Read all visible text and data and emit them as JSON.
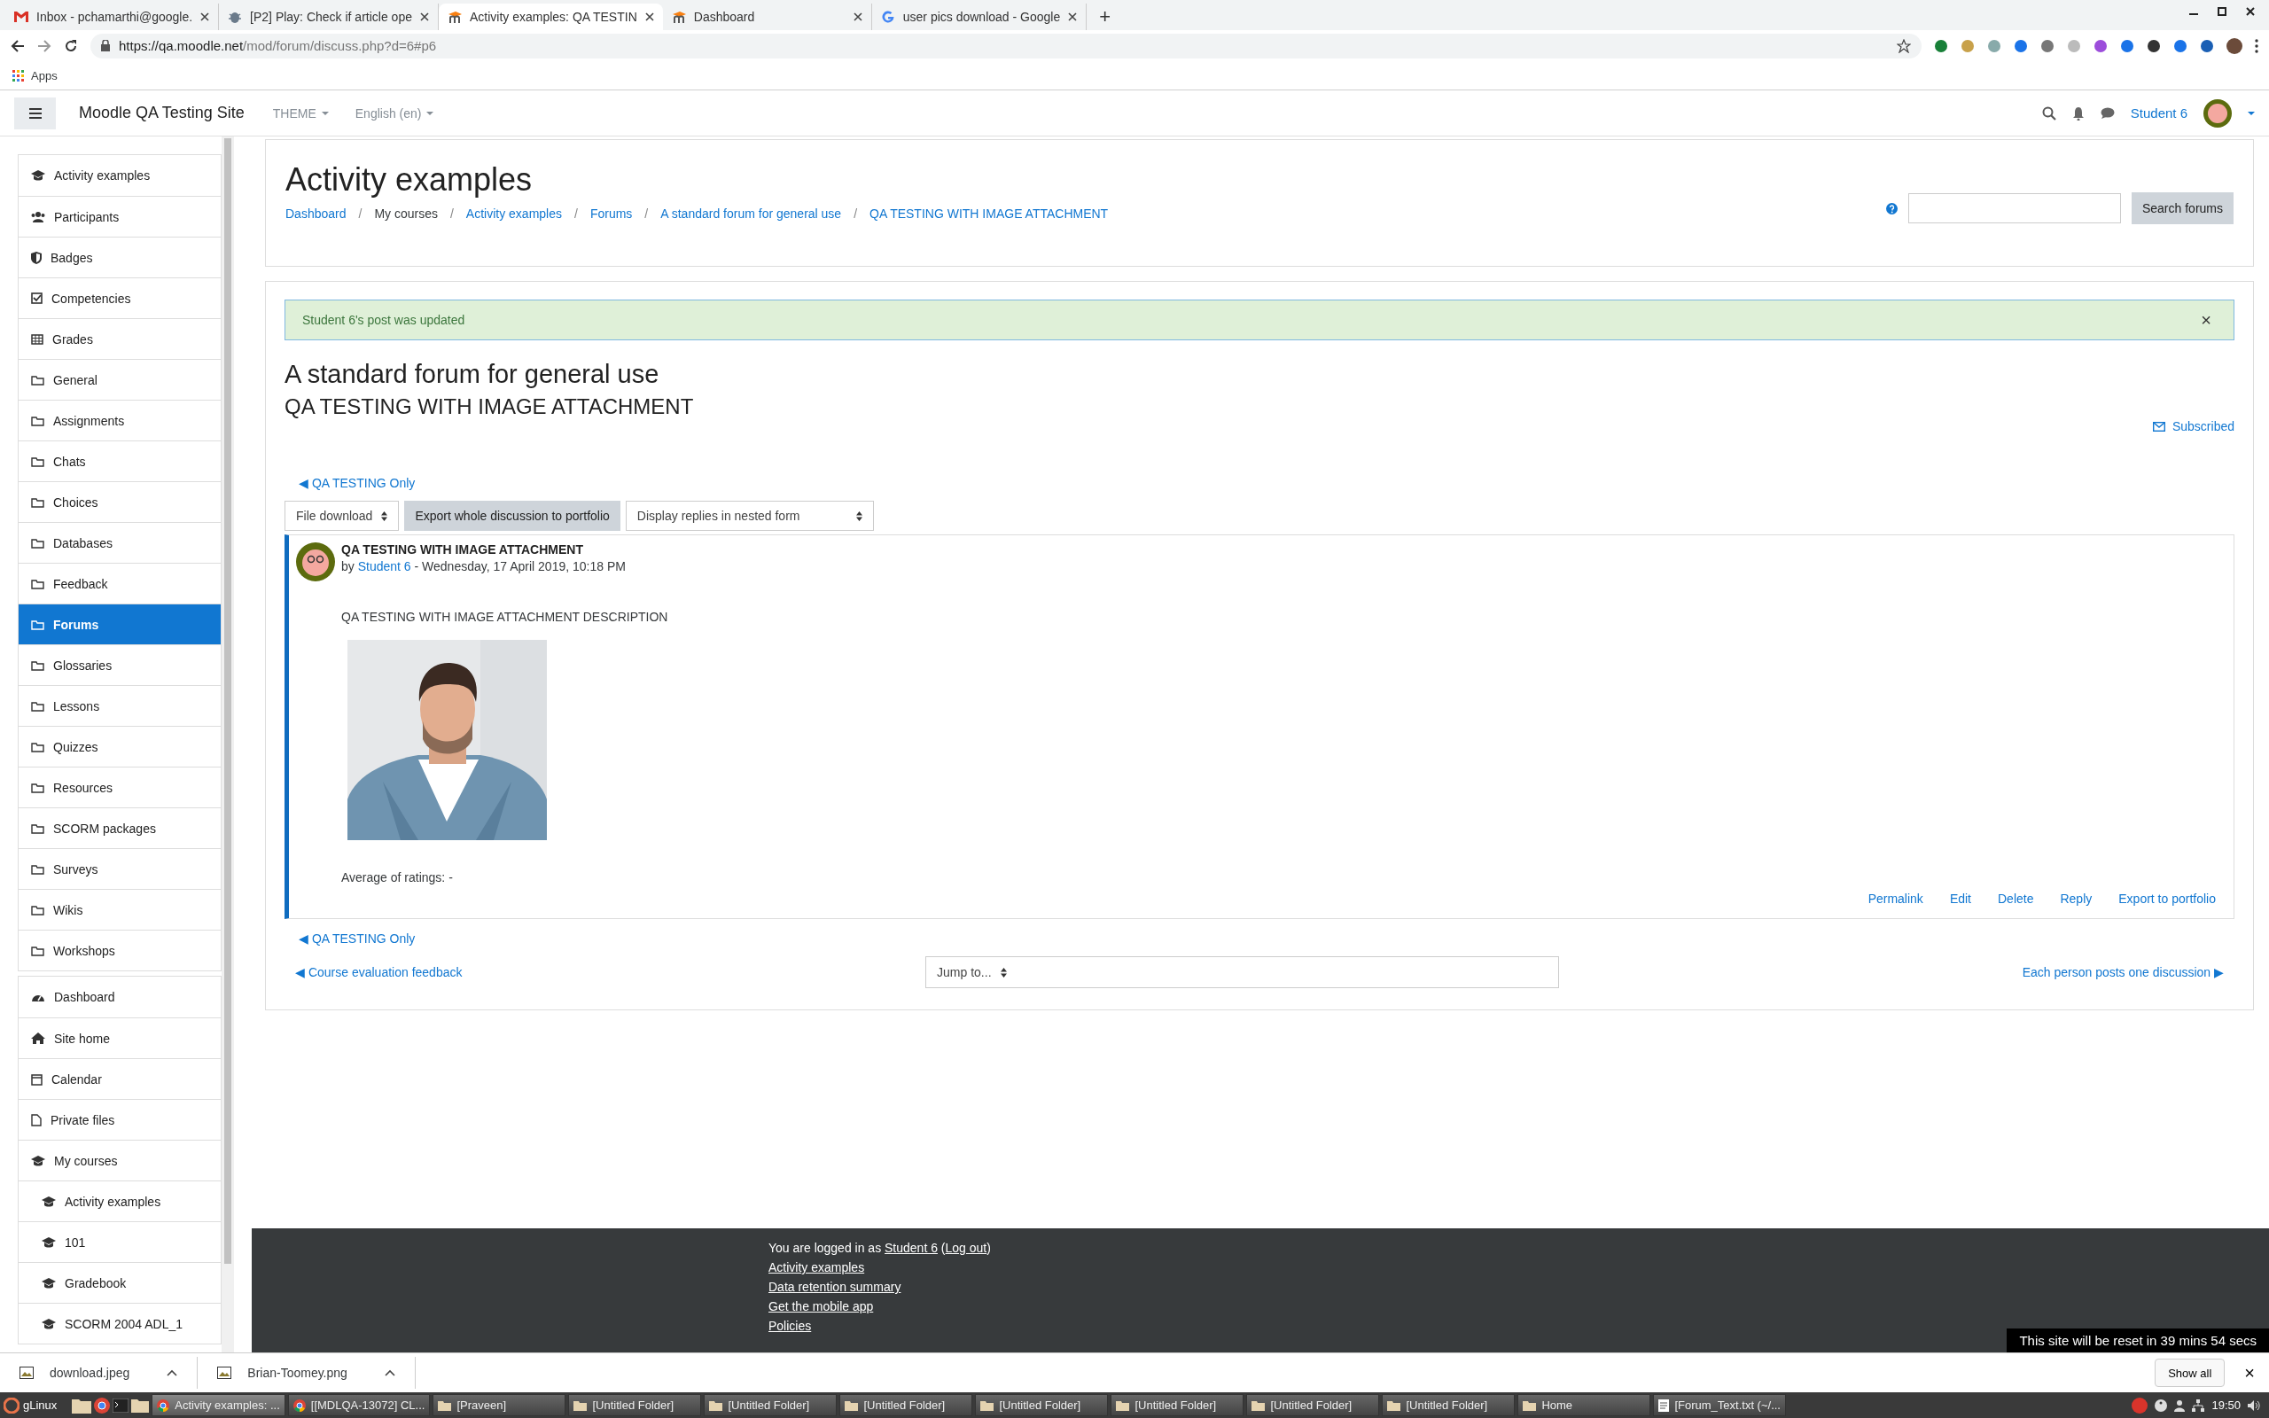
{
  "browser": {
    "tabs": [
      {
        "title": "Inbox - pchamarthi@google.",
        "kind": "gmail",
        "selected": false
      },
      {
        "title": "[P2] Play: Check if article ope",
        "kind": "bug",
        "selected": false
      },
      {
        "title": "Activity examples: QA TESTIN",
        "kind": "moodle",
        "selected": true
      },
      {
        "title": "Dashboard",
        "kind": "moodle",
        "selected": false
      },
      {
        "title": "user pics download - Google",
        "kind": "google",
        "selected": false
      }
    ],
    "new_tab": "+",
    "url_host": "https://qa.moodle.net",
    "url_path": "/mod/forum/discuss.php?d=6#p6",
    "bookmarks": [
      "Apps"
    ]
  },
  "navbar": {
    "site_name": "Moodle QA Testing Site",
    "menus": [
      "THEME",
      "English (en)"
    ],
    "user": "Student 6"
  },
  "sidebar": {
    "groups": [
      [
        {
          "label": "Activity examples",
          "kind": "cap",
          "selected": false
        },
        {
          "label": "Participants",
          "kind": "users",
          "selected": false
        },
        {
          "label": "Badges",
          "kind": "shield",
          "selected": false
        },
        {
          "label": "Competencies",
          "kind": "check",
          "selected": false
        },
        {
          "label": "Grades",
          "kind": "table",
          "selected": false
        },
        {
          "label": "General",
          "kind": "folder",
          "selected": false
        },
        {
          "label": "Assignments",
          "kind": "folder",
          "selected": false
        },
        {
          "label": "Chats",
          "kind": "folder",
          "selected": false
        },
        {
          "label": "Choices",
          "kind": "folder",
          "selected": false
        },
        {
          "label": "Databases",
          "kind": "folder",
          "selected": false
        },
        {
          "label": "Feedback",
          "kind": "folder",
          "selected": false
        },
        {
          "label": "Forums",
          "kind": "folder",
          "selected": true
        },
        {
          "label": "Glossaries",
          "kind": "folder",
          "selected": false
        },
        {
          "label": "Lessons",
          "kind": "folder",
          "selected": false
        },
        {
          "label": "Quizzes",
          "kind": "folder",
          "selected": false
        },
        {
          "label": "Resources",
          "kind": "folder",
          "selected": false
        },
        {
          "label": "SCORM packages",
          "kind": "folder",
          "selected": false
        },
        {
          "label": "Surveys",
          "kind": "folder",
          "selected": false
        },
        {
          "label": "Wikis",
          "kind": "folder",
          "selected": false
        },
        {
          "label": "Workshops",
          "kind": "folder",
          "selected": false
        }
      ],
      [
        {
          "label": "Dashboard",
          "kind": "gauge",
          "selected": false
        },
        {
          "label": "Site home",
          "kind": "home",
          "selected": false
        },
        {
          "label": "Calendar",
          "kind": "calendar",
          "selected": false
        },
        {
          "label": "Private files",
          "kind": "file",
          "selected": false
        },
        {
          "label": "My courses",
          "kind": "cap",
          "selected": false,
          "children": [
            {
              "label": "Activity examples",
              "kind": "cap",
              "selected": false
            },
            {
              "label": "101",
              "kind": "cap",
              "selected": false
            },
            {
              "label": "Gradebook",
              "kind": "cap",
              "selected": false
            },
            {
              "label": "SCORM 2004 ADL_1",
              "kind": "cap",
              "selected": false
            }
          ]
        }
      ]
    ]
  },
  "header": {
    "title": "Activity examples",
    "separator": "/",
    "breadcrumb": [
      {
        "label": "Dashboard",
        "link": true
      },
      {
        "label": "My courses",
        "link": false
      },
      {
        "label": "Activity examples",
        "link": true
      },
      {
        "label": "Forums",
        "link": true
      },
      {
        "label": "A standard forum for general use",
        "link": true
      },
      {
        "label": "QA TESTING WITH IMAGE ATTACHMENT",
        "link": true
      }
    ],
    "search_button": "Search forums"
  },
  "alert": {
    "message": "Student 6's post was updated",
    "close": "×"
  },
  "forum": {
    "title": "A standard forum for general use",
    "discussion": "QA TESTING WITH IMAGE ATTACHMENT",
    "subscribed": "Subscribed",
    "prev_top": "◀ QA TESTING Only",
    "export_select": "File download",
    "export_button": "Export whole discussion to portfolio",
    "display_select": "Display replies in nested form",
    "post": {
      "subject": "QA TESTING WITH IMAGE ATTACHMENT",
      "by": "by ",
      "author": "Student 6",
      "date": " - Wednesday, 17 April 2019, 10:18 PM",
      "message": "QA TESTING WITH IMAGE ATTACHMENT DESCRIPTION",
      "attachment": {
        "kind": "picture"
      },
      "ratings": "Average of ratings: -",
      "commands": [
        "Permalink",
        "Edit",
        "Delete",
        "Reply",
        "Export to portfolio"
      ]
    },
    "prev_bottom": "◀ QA TESTING Only",
    "prev_activity": "◀ Course evaluation feedback",
    "jump": "Jump to...",
    "next_activity": "Each person posts one discussion ▶"
  },
  "footer": {
    "logged_in": "You are logged in as ",
    "user": "Student 6",
    "open": " (",
    "logout": "Log out",
    "close": ")",
    "links": [
      "Activity examples",
      "Data retention summary",
      "Get the mobile app",
      "Policies"
    ],
    "reset_notice": "This site will be reset in 39 mins 54 secs"
  },
  "downloads": {
    "files": [
      "download.jpeg",
      "Brian-Toomey.png"
    ],
    "show_all": "Show all",
    "close": "×"
  },
  "taskbar": {
    "menu": "gLinux",
    "windows": [
      {
        "label": "Activity examples: ...",
        "kind": "chrome",
        "selected": true
      },
      {
        "label": "[[MDLQA-13072] CL...",
        "kind": "chrome",
        "selected": false
      },
      {
        "label": "[Praveen]",
        "kind": "folder",
        "selected": false
      },
      {
        "label": "[Untitled Folder]",
        "kind": "folder",
        "selected": false
      },
      {
        "label": "[Untitled Folder]",
        "kind": "folder",
        "selected": false
      },
      {
        "label": "[Untitled Folder]",
        "kind": "folder",
        "selected": false
      },
      {
        "label": "[Untitled Folder]",
        "kind": "folder",
        "selected": false
      },
      {
        "label": "[Untitled Folder]",
        "kind": "folder",
        "selected": false
      },
      {
        "label": "[Untitled Folder]",
        "kind": "folder",
        "selected": false
      },
      {
        "label": "[Untitled Folder]",
        "kind": "folder",
        "selected": false
      },
      {
        "label": "Home",
        "kind": "folder",
        "selected": false
      },
      {
        "label": "[Forum_Text.txt (~/...",
        "kind": "text",
        "selected": false
      }
    ],
    "clock": "19:50"
  }
}
